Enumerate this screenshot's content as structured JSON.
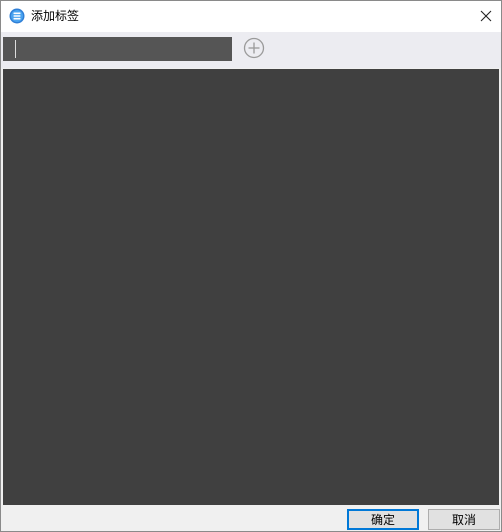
{
  "window": {
    "title": "添加标签",
    "app_icon": "app-logo-icon",
    "close_icon": "close-icon"
  },
  "toolbar": {
    "tag_input_value": "",
    "tag_input_placeholder": "",
    "add_icon": "plus-circle-icon"
  },
  "footer": {
    "ok_label": "确定",
    "cancel_label": "取消"
  },
  "colors": {
    "titlebar_bg": "#ffffff",
    "toolbar_bg": "#ececf1",
    "input_bg": "#555555",
    "tag_area_bg": "#404040",
    "accent": "#0078d7"
  }
}
